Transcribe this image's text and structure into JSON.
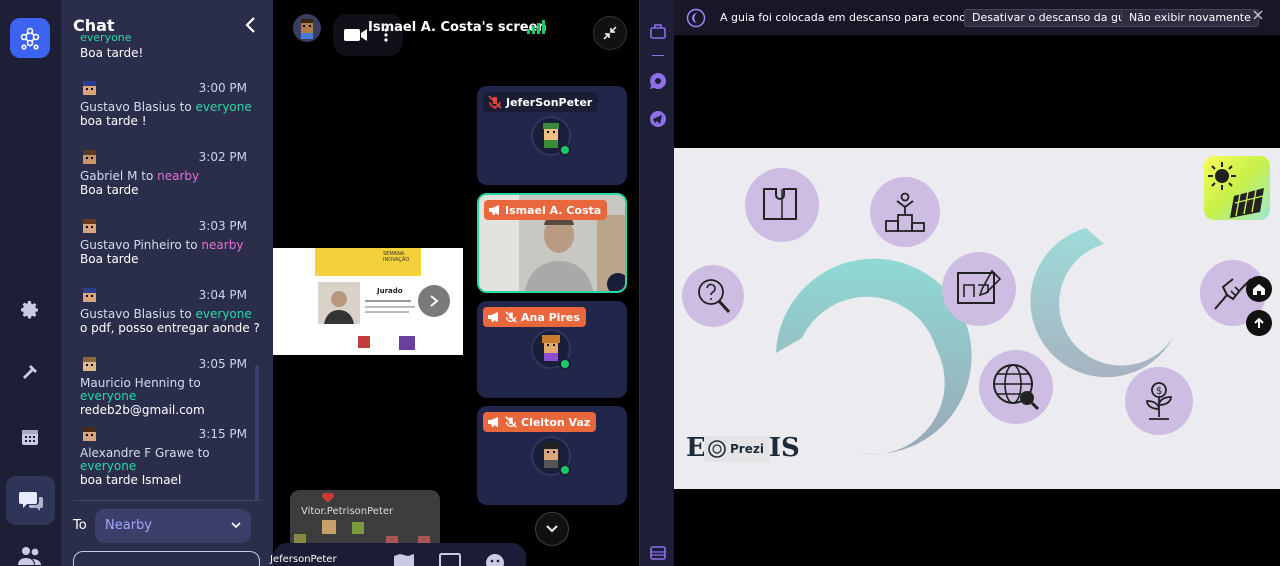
{
  "chat": {
    "title": "Chat",
    "cut_top_text": "everyone",
    "first_body": "Boa tarde!",
    "messages": [
      {
        "time": "3:00 PM",
        "sender": "Gustavo Blasius",
        "to_word": "to",
        "audience": "everyone",
        "body": "boa tarde !"
      },
      {
        "time": "3:02 PM",
        "sender": "Gabriel M",
        "to_word": "to",
        "audience": "nearby",
        "body": "Boa tarde"
      },
      {
        "time": "3:03 PM",
        "sender": "Gustavo Pinheiro",
        "to_word": "to",
        "audience": "nearby",
        "body": "Boa tarde"
      },
      {
        "time": "3:04 PM",
        "sender": "Gustavo Blasius",
        "to_word": "to",
        "audience": "everyone",
        "body": "o pdf, posso entregar aonde ?"
      },
      {
        "time": "3:05 PM",
        "sender": "Mauricio Henning",
        "to_word": "to",
        "audience": "everyone",
        "body": "redeb2b@gmail.com"
      },
      {
        "time": "3:15 PM",
        "sender": "Alexandre F Grawe",
        "to_word": "to",
        "audience": "everyone",
        "body": "boa tarde Ismael"
      }
    ],
    "to_label": "To",
    "to_value": "Nearby"
  },
  "video": {
    "screen_title": "Ismael A. Costa's screen",
    "participants": [
      {
        "name": "JeferSonPeter",
        "muted": true
      },
      {
        "name": "Ismael A. Costa",
        "presenting": true
      },
      {
        "name": "Ana Pires",
        "muted": true
      },
      {
        "name": "Cleiton Vaz",
        "muted": true
      }
    ],
    "minimap_label": "Vitor.PetrisonPeter",
    "bottom_name": "JefersonPeter",
    "share_slide": {
      "heading": "Jurado",
      "event": "SEMANA INOVAÇÃO"
    }
  },
  "guide": {
    "notice_text": "A guia foi colocada em descanso para economizar mem",
    "btn_disable": "Desativar o descanso da guia",
    "btn_hide": "Não exibir novamente",
    "brand_left": "E",
    "brand_right": "IS",
    "prezi_label": "Prezi"
  },
  "colors": {
    "everyone": "#27d9a4",
    "nearby": "#e86fd6",
    "accent": "#3d64f0",
    "tag_orange": "#e8673d",
    "teal_arc": "#8fd3cf",
    "lavender": "#cdbde3"
  },
  "icons": [
    "app-logo-icon",
    "gear-icon",
    "hammer-icon",
    "calendar-icon",
    "chat-icon",
    "users-icon",
    "chevron-left-icon",
    "camera-icon",
    "signal-icon",
    "minimize-icon",
    "chevron-down-icon",
    "mic-off-icon",
    "megaphone-icon",
    "map-icon",
    "screen-icon",
    "emoji-icon",
    "home-icon",
    "top-icon"
  ]
}
